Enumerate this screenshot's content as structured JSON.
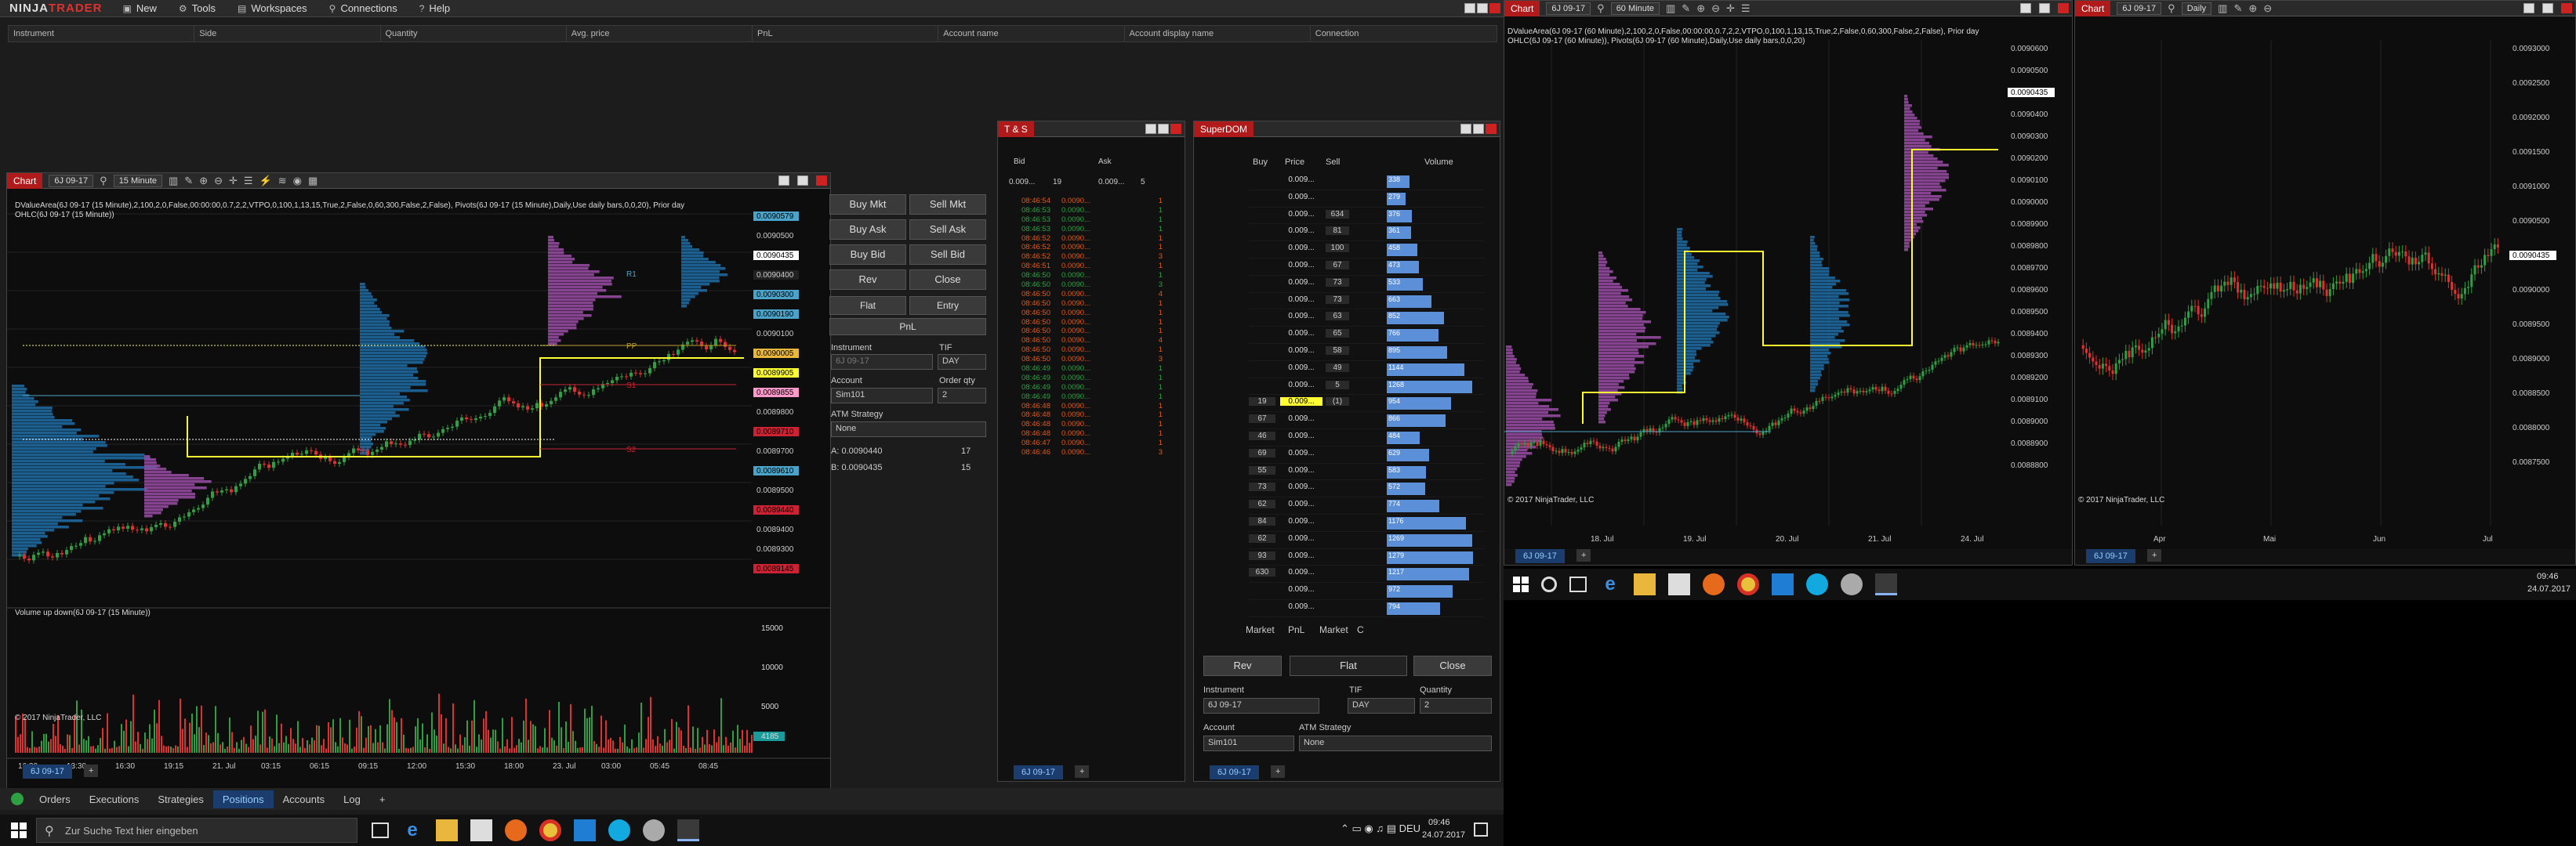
{
  "app": {
    "logo_a": "NINJA",
    "logo_b": "TRADER"
  },
  "menu": [
    {
      "label": "New",
      "icon": "new-icon"
    },
    {
      "label": "Tools",
      "icon": "tools-icon"
    },
    {
      "label": "Workspaces",
      "icon": "workspaces-icon"
    },
    {
      "label": "Connections",
      "icon": "connections-icon"
    },
    {
      "label": "Help",
      "icon": "help-icon"
    }
  ],
  "positions": {
    "columns": [
      "Instrument",
      "Side",
      "Quantity",
      "Avg. price",
      "PnL",
      "Account name",
      "Account display name",
      "Connection"
    ]
  },
  "chart1": {
    "title": "Chart",
    "instrument": "6J 09-17",
    "interval": "15 Minute",
    "label1": "DValueArea(6J 09-17 (15 Minute),2,100,2,0,False,00:00:00,0.7,2,2,VTPO,0,100,1,13,15,True,2,False,0,60,300,False,2,False), Pivots(6J 09-17 (15 Minute),Daily,Use daily bars,0,0,20), Prior day",
    "label2": "OHLC(6J 09-17 (15 Minute))",
    "volume_label": "Volume up down(6J 09-17 (15 Minute))",
    "copyright": "© 2017 NinjaTrader, LLC",
    "prices": [
      "0.0090579",
      "0.0090500",
      "0.0090435",
      "0.0090400",
      "0.0090300",
      "0.0090190",
      "0.0090100",
      "0.0090005",
      "0.0089905",
      "0.0089855",
      "0.0089800",
      "0.0089710",
      "0.0089700",
      "0.0089610",
      "0.0089500",
      "0.0089440",
      "0.0089400",
      "0.0089300",
      "0.0089145"
    ],
    "vol_ticks": [
      "15000",
      "10000",
      "5000",
      "4185"
    ],
    "xlabels": [
      "16:30",
      "13:30",
      "16:30",
      "19:15",
      "21. Jul",
      "03:15",
      "06:15",
      "09:15",
      "12:00",
      "15:30",
      "18:00",
      "23. Jul",
      "03:00",
      "05:45",
      "08:45"
    ],
    "tab": "6J 09-17",
    "levels": [
      "R1",
      "PP",
      "S1",
      "S2"
    ]
  },
  "chart_trader": {
    "buy_mkt": "Buy Mkt",
    "sell_mkt": "Sell Mkt",
    "buy_ask": "Buy Ask",
    "sell_ask": "Sell Ask",
    "buy_bid": "Buy Bid",
    "sell_bid": "Sell Bid",
    "rev": "Rev",
    "close": "Close",
    "flat": "Flat",
    "entry": "Entry",
    "pnl": "PnL",
    "instrument_label": "Instrument",
    "instrument": "6J 09-17",
    "tif_label": "TIF",
    "tif": "DAY",
    "account_label": "Account",
    "account": "Sim101",
    "order_qty_label": "Order qty",
    "order_qty": "2",
    "atm_label": "ATM Strategy",
    "atm": "None",
    "ask_line": "A: 0.0090440",
    "ask_qty": "17",
    "bid_line": "B: 0.0090435",
    "bid_qty": "15"
  },
  "ts": {
    "title": "T & S",
    "bid_label": "Bid",
    "ask_label": "Ask",
    "bid_price": "0.009...",
    "bid_size": "19",
    "ask_price": "0.009...",
    "ask_size": "5",
    "tab": "6J 09-17",
    "rows": [
      [
        "08:46:54",
        "0.0090...",
        "1",
        "r"
      ],
      [
        "08:46:53",
        "0.0090...",
        "1",
        "g"
      ],
      [
        "08:46:53",
        "0.0090...",
        "1",
        "g"
      ],
      [
        "08:46:53",
        "0.0090...",
        "1",
        "g"
      ],
      [
        "08:46:52",
        "0.0090...",
        "1",
        "r"
      ],
      [
        "08:46:52",
        "0.0090...",
        "1",
        "r"
      ],
      [
        "08:46:52",
        "0.0090...",
        "3",
        "r"
      ],
      [
        "08:46:51",
        "0.0090...",
        "1",
        "r"
      ],
      [
        "08:46:50",
        "0.0090...",
        "1",
        "g"
      ],
      [
        "08:46:50",
        "0.0090...",
        "3",
        "g"
      ],
      [
        "08:46:50",
        "0.0090...",
        "4",
        "r"
      ],
      [
        "08:46:50",
        "0.0090...",
        "1",
        "r"
      ],
      [
        "08:46:50",
        "0.0090...",
        "1",
        "r"
      ],
      [
        "08:46:50",
        "0.0090...",
        "1",
        "r"
      ],
      [
        "08:46:50",
        "0.0090...",
        "1",
        "r"
      ],
      [
        "08:46:50",
        "0.0090...",
        "4",
        "r"
      ],
      [
        "08:46:50",
        "0.0090...",
        "1",
        "r"
      ],
      [
        "08:46:50",
        "0.0090...",
        "3",
        "r"
      ],
      [
        "08:46:49",
        "0.0090...",
        "1",
        "g"
      ],
      [
        "08:46:49",
        "0.0090...",
        "1",
        "g"
      ],
      [
        "08:46:49",
        "0.0090...",
        "1",
        "g"
      ],
      [
        "08:46:49",
        "0.0090...",
        "1",
        "g"
      ],
      [
        "08:46:48",
        "0.0090...",
        "1",
        "r"
      ],
      [
        "08:46:48",
        "0.0090...",
        "1",
        "r"
      ],
      [
        "08:46:48",
        "0.0090...",
        "1",
        "r"
      ],
      [
        "08:46:48",
        "0.0090...",
        "1",
        "r"
      ],
      [
        "08:46:47",
        "0.0090...",
        "1",
        "r"
      ],
      [
        "08:46:46",
        "0.0090...",
        "3",
        "r"
      ]
    ]
  },
  "superdom": {
    "title": "SuperDOM",
    "col_buy": "Buy",
    "col_price": "Price",
    "col_sell": "Sell",
    "col_volume": "Volume",
    "rows": [
      [
        "",
        "0.009...",
        "",
        ""
      ],
      [
        "",
        "0.009...",
        "",
        ""
      ],
      [
        "",
        "0.009...",
        "634",
        ""
      ],
      [
        "",
        "0.009...",
        "81",
        ""
      ],
      [
        "",
        "0.009...",
        "100",
        ""
      ],
      [
        "",
        "0.009...",
        "67",
        ""
      ],
      [
        "",
        "0.009...",
        "73",
        ""
      ],
      [
        "",
        "0.009...",
        "73",
        ""
      ],
      [
        "",
        "0.009...",
        "63",
        ""
      ],
      [
        "",
        "0.009...",
        "65",
        ""
      ],
      [
        "",
        "0.009...",
        "58",
        ""
      ],
      [
        "",
        "0.009...",
        "49",
        ""
      ],
      [
        "",
        "0.009...",
        "5",
        ""
      ],
      [
        "19",
        "0.009...",
        "(1)",
        ""
      ],
      [
        "67",
        "0.009...",
        "",
        ""
      ],
      [
        "46",
        "0.009...",
        "",
        ""
      ],
      [
        "69",
        "0.009...",
        "",
        ""
      ],
      [
        "55",
        "0.009...",
        "",
        ""
      ],
      [
        "73",
        "0.009...",
        "",
        ""
      ],
      [
        "62",
        "0.009...",
        "",
        ""
      ],
      [
        "84",
        "0.009...",
        "",
        ""
      ],
      [
        "62",
        "0.009...",
        "",
        ""
      ],
      [
        "93",
        "0.009...",
        "",
        ""
      ],
      [
        "630",
        "0.009...",
        "",
        ""
      ],
      [
        "",
        "0.009...",
        "",
        ""
      ],
      [
        "",
        "0.009...",
        "",
        ""
      ]
    ],
    "volumes": [
      "338",
      "279",
      "376",
      "361",
      "458",
      "473",
      "533",
      "663",
      "852",
      "766",
      "895",
      "1144",
      "1268",
      "954",
      "866",
      "484",
      "629",
      "583",
      "572",
      "774",
      "1176",
      "1269",
      "1279",
      "1217",
      "972",
      "794"
    ],
    "market": "Market",
    "pnl": "PnL",
    "market2": "Market",
    "c": "C",
    "rev": "Rev",
    "flat": "Flat",
    "close": "Close",
    "instrument_label": "Instrument",
    "instrument": "6J 09-17",
    "tif_label": "TIF",
    "tif": "DAY",
    "qty_label": "Quantity",
    "qty": "2",
    "account_label": "Account",
    "account": "Sim101",
    "atm_label": "ATM Strategy",
    "atm": "None",
    "tab": "6J 09-17"
  },
  "bottom_tabs": [
    "Orders",
    "Executions",
    "Strategies",
    "Positions",
    "Accounts",
    "Log"
  ],
  "taskbar1": {
    "search": "Zur Suche Text hier eingeben",
    "time": "09:46",
    "date": "24.07.2017"
  },
  "chart2": {
    "title": "Chart",
    "instrument": "6J 09-17",
    "interval": "60 Minute",
    "label1": "DValueArea(6J 09-17 (60 Minute),2,100,2,0,False,00:00:00,0.7,2,2,VTPO,0,100,1,13,15,True,2,False,0,60,300,False,2,False), Prior day",
    "label2": "OHLC(6J 09-17 (60 Minute)), Pivots(6J 09-17 (60 Minute),Daily,Use daily bars,0,0,20)",
    "copyright": "© 2017 NinjaTrader, LLC",
    "prices": [
      "0.0090600",
      "0.0090500",
      "0.0090435",
      "0.0090400",
      "0.0090300",
      "0.0090200",
      "0.0090100",
      "0.0090000",
      "0.0089900",
      "0.0089800",
      "0.0089700",
      "0.0089600",
      "0.0089500",
      "0.0089400",
      "0.0089300",
      "0.0089200",
      "0.0089100",
      "0.0089000",
      "0.0088900",
      "0.0088800"
    ],
    "xlabels": [
      "18. Jul",
      "19. Jul",
      "20. Jul",
      "21. Jul",
      "24. Jul"
    ],
    "tab": "6J 09-17"
  },
  "chart3": {
    "title": "Chart",
    "instrument": "6J 09-17",
    "interval": "Daily",
    "copyright": "© 2017 NinjaTrader, LLC",
    "prices": [
      "0.0093000",
      "0.0092500",
      "0.0092000",
      "0.0091500",
      "0.0091000",
      "0.0090500",
      "0.0090435",
      "0.0090000",
      "0.0089500",
      "0.0089000",
      "0.0088500",
      "0.0088000",
      "0.0087500"
    ],
    "xlabels": [
      "Apr",
      "Mai",
      "Jun",
      "Jul"
    ],
    "tab": "6J 09-17"
  },
  "taskbar2": {
    "time": "09:46",
    "date": "24.07.2017"
  },
  "colors": {
    "accent_red": "#b11a1a",
    "up": "#2ea043",
    "down": "#e03030",
    "value_area": "#1f6fa8",
    "tpo": "#9b4ea8",
    "poc": "#ffff33",
    "dom_bar": "#5b8fd8"
  }
}
